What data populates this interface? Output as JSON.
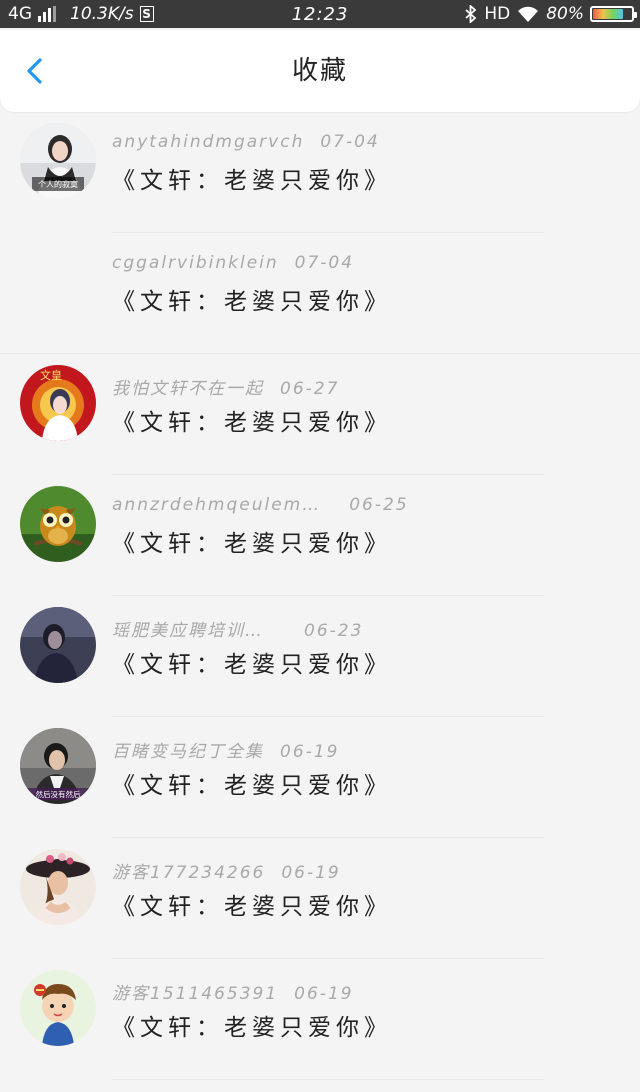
{
  "status_bar": {
    "network": "4G",
    "speed": "10.3K/s",
    "s_icon": "S",
    "time": "12:23",
    "hd": "HD",
    "battery": "80%",
    "battery_level": 0.8
  },
  "header": {
    "title": "收藏",
    "back_icon": "chevron-left-icon",
    "accent": "#2196f3"
  },
  "favorites": [
    {
      "user": "anytahindmgarvch",
      "date": "07-04",
      "text": "《文轩：老婆只爱你》",
      "avatar": "avatar-photo-girl"
    },
    {
      "user": "cggalrvibinklein",
      "date": "07-04",
      "text": "《文轩：老婆只爱你》",
      "avatar": "none"
    },
    {
      "user": "我怕文轩不在一起",
      "date": "06-27",
      "text": "《文轩：老婆只爱你》",
      "avatar": "avatar-red-poster"
    },
    {
      "user": "annzrdehmqeulem…",
      "date": "06-25",
      "text": "《文轩：老婆只爱你》",
      "avatar": "avatar-owl"
    },
    {
      "user": "瑶肥美应聘培训…",
      "date": "06-23",
      "text": "《文轩：老婆只爱你》",
      "avatar": "avatar-dark-photo"
    },
    {
      "user": "百睹变马纪丁全集",
      "date": "06-19",
      "text": "《文轩：老婆只爱你》",
      "avatar": "avatar-man-photo"
    },
    {
      "user": "游客177234266",
      "date": "06-19",
      "text": "《文轩：老婆只爱你》",
      "avatar": "avatar-woman-hat"
    },
    {
      "user": "游客1511465391",
      "date": "06-19",
      "text": "《文轩：老婆只爱你》",
      "avatar": "avatar-cartoon-boy"
    }
  ],
  "avatar_texts": {
    "photo_girl": "个人的寂寞",
    "red_poster": "文皇",
    "man_photo": "然后没有然后"
  }
}
